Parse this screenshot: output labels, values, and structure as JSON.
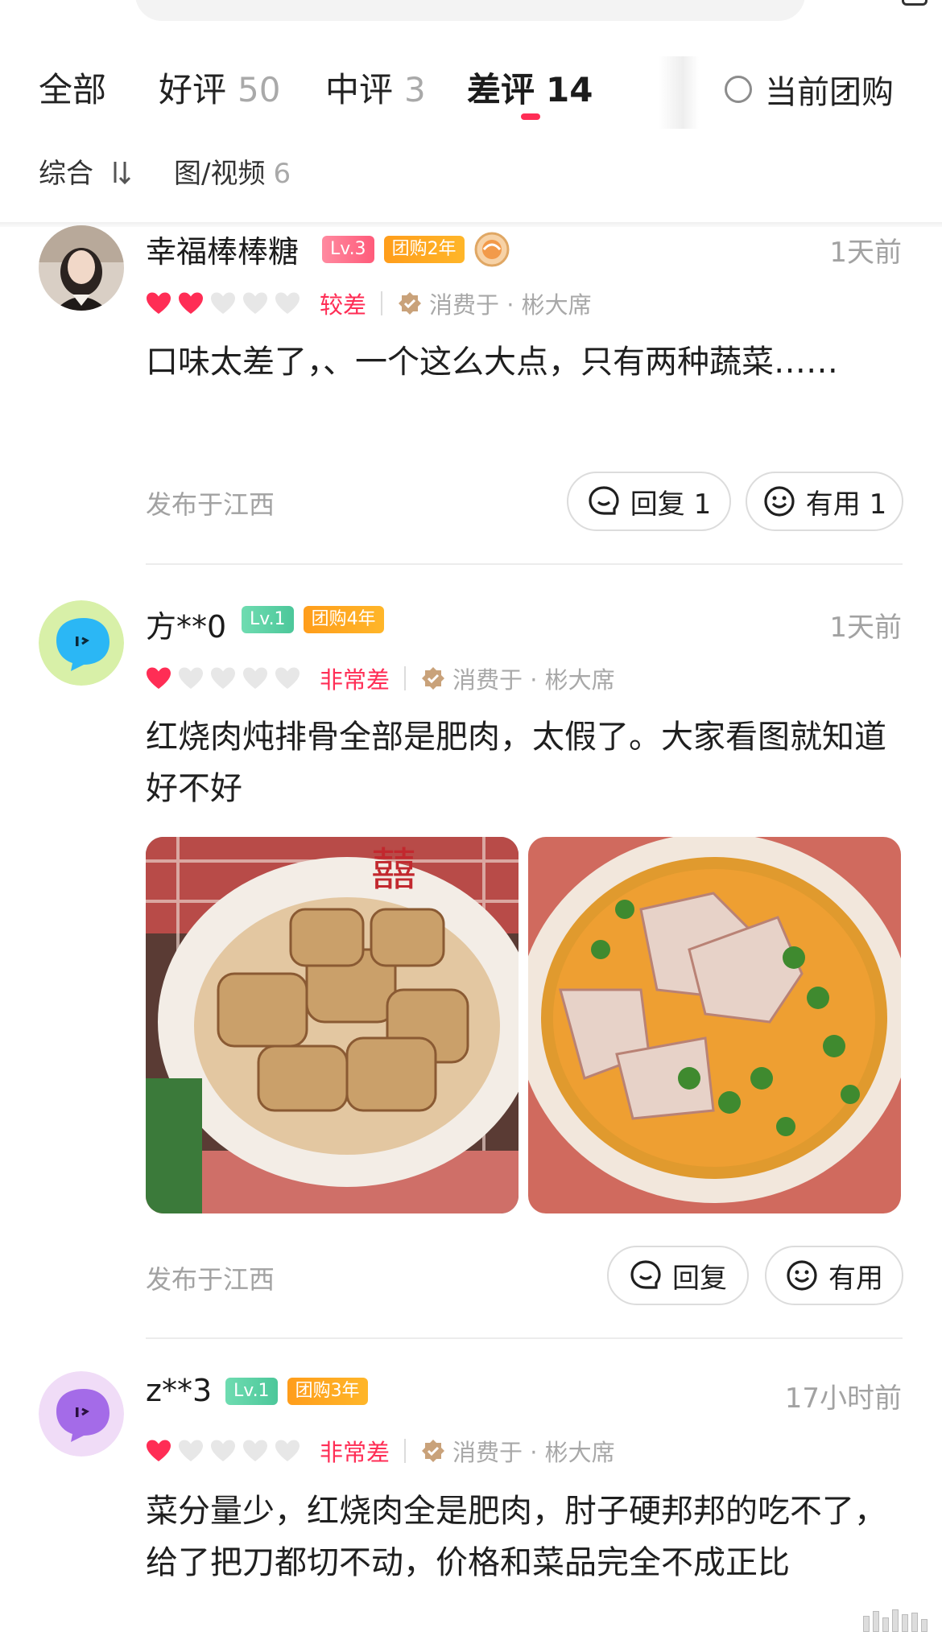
{
  "colors": {
    "accent": "#ff2d55",
    "group_badge": "#ff9f1c",
    "lv3": "#ff6b86",
    "lv1": "#5ed1a6"
  },
  "tabs": [
    {
      "label": "全部",
      "count": ""
    },
    {
      "label": "好评",
      "count": "50"
    },
    {
      "label": "中评",
      "count": "3"
    },
    {
      "label": "差评",
      "count": "14",
      "active": true
    }
  ],
  "current_group_filter": "当前团购",
  "subtabs": [
    {
      "label": "综合",
      "icon": "sort-icon"
    },
    {
      "label": "图/视频",
      "count": "6"
    }
  ],
  "reviews": [
    {
      "username": "幸福棒棒糖",
      "level": "Lv.3",
      "group_years": "团购2年",
      "time": "1天前",
      "hearts_filled": 2,
      "hearts_total": 5,
      "rating_label": "较差",
      "consumed": "消费于 · 彬大席",
      "content": "口味太差了，、一个这么大点，只有两种蔬菜……",
      "published": "发布于江西",
      "reply_label": "回复 1",
      "useful_label": "有用 1"
    },
    {
      "username": "方**0",
      "level": "Lv.1",
      "group_years": "团购4年",
      "time": "1天前",
      "hearts_filled": 1,
      "hearts_total": 5,
      "rating_label": "非常差",
      "consumed": "消费于 · 彬大席",
      "content": "红烧肉炖排骨全部是肥肉，太假了。大家看图就知道好不好",
      "published": "发布于江西",
      "reply_label": "回复",
      "useful_label": "有用"
    },
    {
      "username": "z**3",
      "level": "Lv.1",
      "group_years": "团购3年",
      "time": "17小时前",
      "hearts_filled": 1,
      "hearts_total": 5,
      "rating_label": "非常差",
      "consumed": "消费于 · 彬大席",
      "content": "菜分量少，红烧肉全是肥肉，肘子硬邦邦的吃不了，给了把刀都切不动，价格和菜品完全不成正比"
    }
  ]
}
